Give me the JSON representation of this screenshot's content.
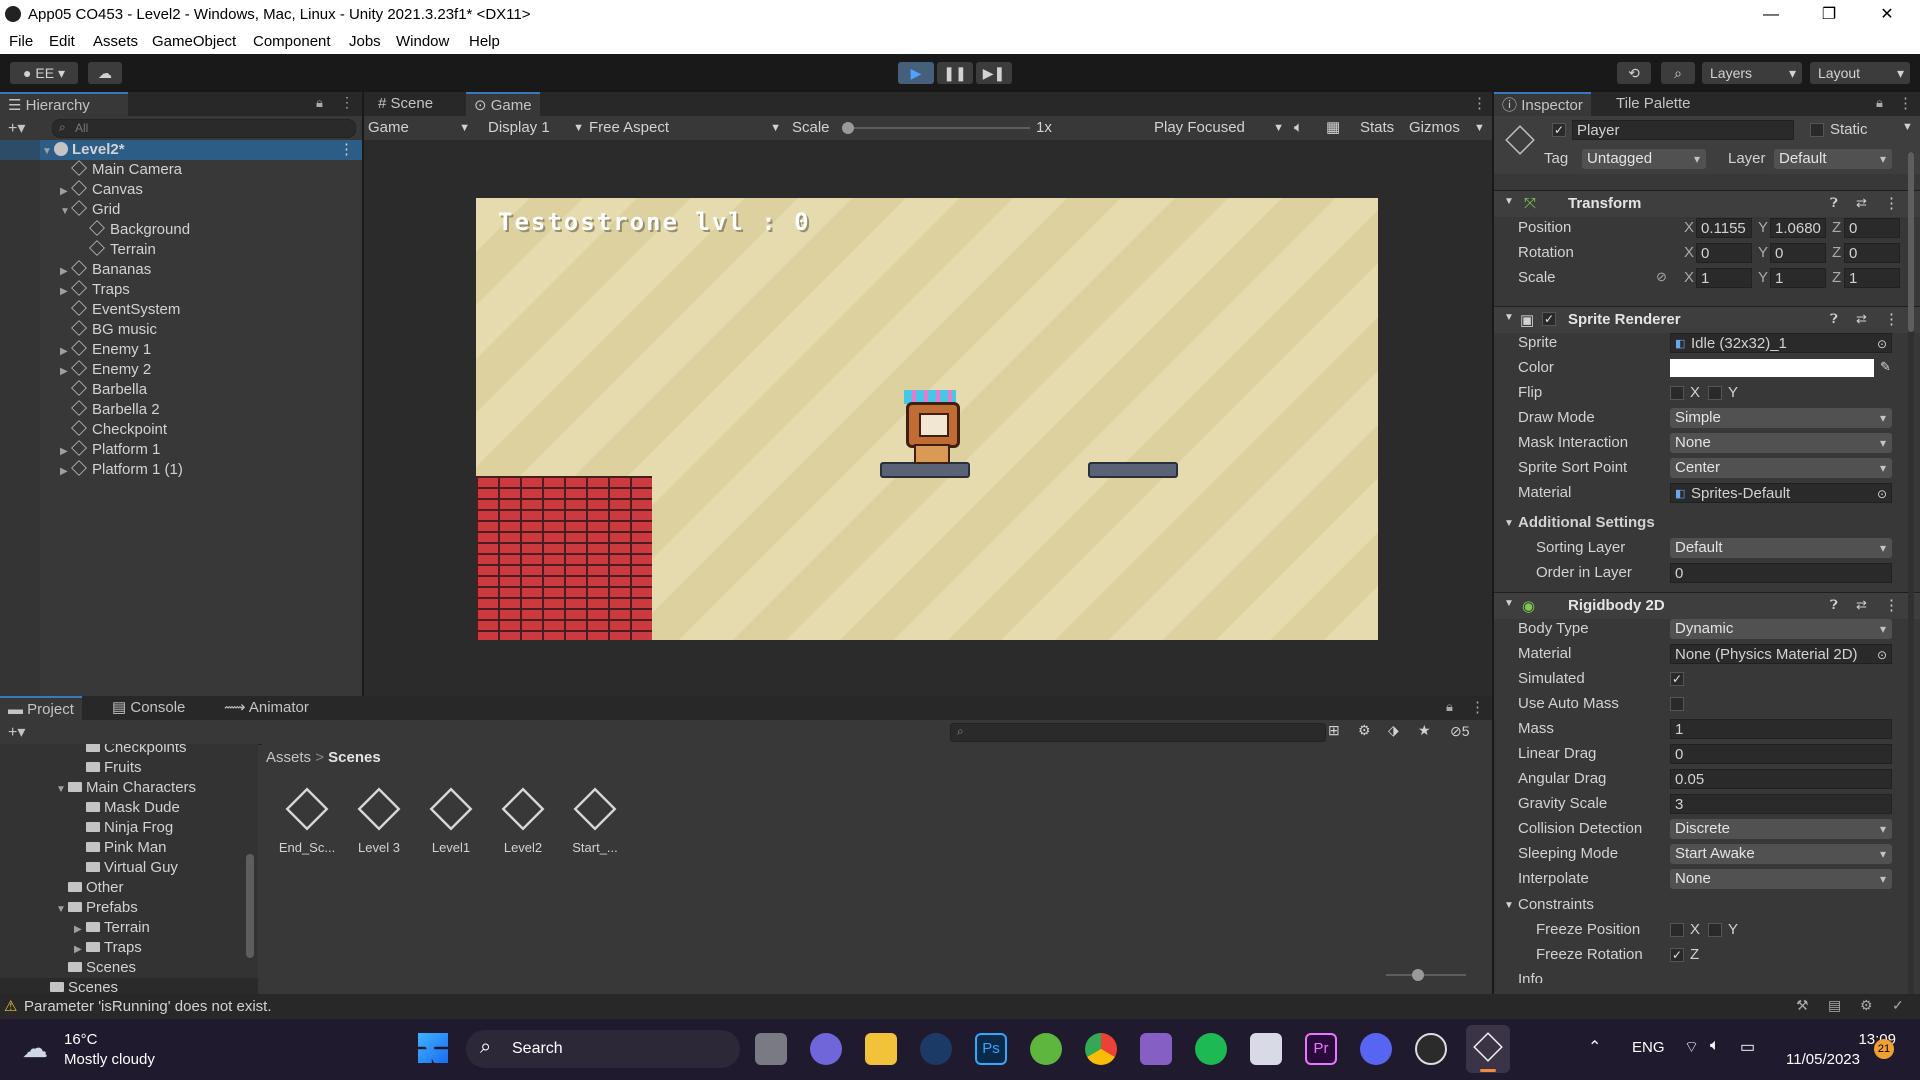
{
  "window": {
    "title": "App05 CO453 - Level2 - Windows, Mac, Linux - Unity 2021.3.23f1* <DX11>",
    "minimize": "—",
    "restore": "❐",
    "close": "✕"
  },
  "menu": [
    "File",
    "Edit",
    "Assets",
    "GameObject",
    "Component",
    "Jobs",
    "Window",
    "Help"
  ],
  "toolbar": {
    "account": "EE",
    "layers": "Layers",
    "layout": "Layout"
  },
  "hierarchy": {
    "tab": "Hierarchy",
    "search_placeholder": "All",
    "scene": "Level2*",
    "items": [
      {
        "label": "Main Camera",
        "indent": 1,
        "arrow": ""
      },
      {
        "label": "Canvas",
        "indent": 1,
        "arrow": "▶"
      },
      {
        "label": "Grid",
        "indent": 1,
        "arrow": "▼"
      },
      {
        "label": "Background",
        "indent": 2,
        "arrow": ""
      },
      {
        "label": "Terrain",
        "indent": 2,
        "arrow": ""
      },
      {
        "label": "Bananas",
        "indent": 1,
        "arrow": "▶"
      },
      {
        "label": "Traps",
        "indent": 1,
        "arrow": "▶"
      },
      {
        "label": "EventSystem",
        "indent": 1,
        "arrow": ""
      },
      {
        "label": "BG music",
        "indent": 1,
        "arrow": ""
      },
      {
        "label": "Enemy 1",
        "indent": 1,
        "arrow": "▶"
      },
      {
        "label": "Enemy 2",
        "indent": 1,
        "arrow": "▶"
      },
      {
        "label": "Barbella",
        "indent": 1,
        "arrow": ""
      },
      {
        "label": "Barbella 2",
        "indent": 1,
        "arrow": ""
      },
      {
        "label": "Checkpoint",
        "indent": 1,
        "arrow": ""
      },
      {
        "label": "Platform 1",
        "indent": 1,
        "arrow": "▶"
      },
      {
        "label": "Platform 1 (1)",
        "indent": 1,
        "arrow": "▶"
      }
    ]
  },
  "game": {
    "tabs": [
      "Scene",
      "Game"
    ],
    "display_mode": "Game",
    "display": "Display 1",
    "aspect": "Free Aspect",
    "scale_label": "Scale",
    "scale_value": "1x",
    "play_focused": "Play Focused",
    "stats": "Stats",
    "gizmos": "Gizmos",
    "hud_text": "Testostrone lvl : 0"
  },
  "inspector": {
    "tabs": [
      "Inspector",
      "Tile Palette"
    ],
    "object_name": "Player",
    "static_label": "Static",
    "tag_label": "Tag",
    "tag_value": "Untagged",
    "layer_label": "Layer",
    "layer_value": "Default",
    "transform": {
      "title": "Transform",
      "position_label": "Position",
      "rotation_label": "Rotation",
      "scale_label": "Scale",
      "pos": [
        "0.1155",
        "1.0680",
        "0"
      ],
      "rot": [
        "0",
        "0",
        "0"
      ],
      "scl": [
        "1",
        "1",
        "1"
      ]
    },
    "sprite_renderer": {
      "title": "Sprite Renderer",
      "rows": [
        {
          "label": "Sprite",
          "value": "Idle (32x32)_1",
          "kind": "object"
        },
        {
          "label": "Color",
          "value": "",
          "kind": "color"
        },
        {
          "label": "Flip",
          "value": "",
          "kind": "flip"
        },
        {
          "label": "Draw Mode",
          "value": "Simple",
          "kind": "drop"
        },
        {
          "label": "Mask Interaction",
          "value": "None",
          "kind": "drop"
        },
        {
          "label": "Sprite Sort Point",
          "value": "Center",
          "kind": "drop"
        },
        {
          "label": "Material",
          "value": "Sprites-Default",
          "kind": "object"
        }
      ],
      "additional": "Additional Settings",
      "sorting_layer_label": "Sorting Layer",
      "sorting_layer_value": "Default",
      "order_label": "Order in Layer",
      "order_value": "0"
    },
    "rigidbody": {
      "title": "Rigidbody 2D",
      "rows": [
        {
          "label": "Body Type",
          "value": "Dynamic",
          "kind": "drop"
        },
        {
          "label": "Material",
          "value": "None (Physics Material 2D)",
          "kind": "object"
        },
        {
          "label": "Simulated",
          "value": "✓",
          "kind": "check"
        },
        {
          "label": "Use Auto Mass",
          "value": "",
          "kind": "check"
        },
        {
          "label": "Mass",
          "value": "1",
          "kind": "field"
        },
        {
          "label": "Linear Drag",
          "value": "0",
          "kind": "field"
        },
        {
          "label": "Angular Drag",
          "value": "0.05",
          "kind": "field"
        },
        {
          "label": "Gravity Scale",
          "value": "3",
          "kind": "field"
        },
        {
          "label": "Collision Detection",
          "value": "Discrete",
          "kind": "drop"
        },
        {
          "label": "Sleeping Mode",
          "value": "Start Awake",
          "kind": "drop"
        },
        {
          "label": "Interpolate",
          "value": "None",
          "kind": "drop"
        }
      ],
      "constraints": "Constraints",
      "freeze_position": "Freeze Position",
      "freeze_rotation": "Freeze Rotation",
      "info": "Info"
    }
  },
  "project": {
    "tabs": [
      "Project",
      "Console",
      "Animator"
    ],
    "tree": [
      {
        "label": "Checkpoints",
        "indent": 3,
        "arrow": ""
      },
      {
        "label": "Fruits",
        "indent": 3,
        "arrow": ""
      },
      {
        "label": "Main Characters",
        "indent": 2,
        "arrow": "▼"
      },
      {
        "label": "Mask Dude",
        "indent": 3,
        "arrow": ""
      },
      {
        "label": "Ninja Frog",
        "indent": 3,
        "arrow": ""
      },
      {
        "label": "Pink Man",
        "indent": 3,
        "arrow": ""
      },
      {
        "label": "Virtual Guy",
        "indent": 3,
        "arrow": ""
      },
      {
        "label": "Other",
        "indent": 2,
        "arrow": ""
      },
      {
        "label": "Prefabs",
        "indent": 2,
        "arrow": "▼"
      },
      {
        "label": "Terrain",
        "indent": 3,
        "arrow": "▶"
      },
      {
        "label": "Traps",
        "indent": 3,
        "arrow": "▶"
      },
      {
        "label": "Scenes",
        "indent": 2,
        "arrow": ""
      },
      {
        "label": "Scenes",
        "indent": 1,
        "arrow": ""
      }
    ],
    "breadcrumb_root": "Assets",
    "breadcrumb_current": "Scenes",
    "hidden_count": "5",
    "assets": [
      "End_Sc...",
      "Level 3",
      "Level1",
      "Level2",
      "Start_..."
    ]
  },
  "status": {
    "message": "Parameter 'isRunning' does not exist."
  },
  "taskbar": {
    "temp": "16°C",
    "weather": "Mostly cloudy",
    "search": "Search",
    "lang": "ENG",
    "time": "13:09",
    "date": "11/05/2023",
    "notifications": "21"
  }
}
